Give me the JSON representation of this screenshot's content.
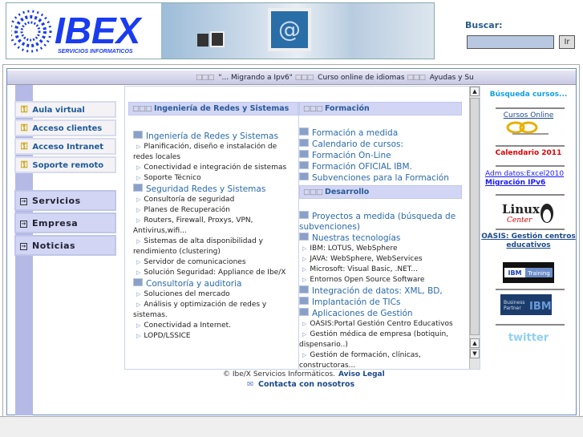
{
  "header": {
    "logo_text": "IBEX",
    "logo_sub": "SERVICIOS INFORMATICOS",
    "search_label": "Buscar:",
    "search_value": "",
    "search_button": "Ir"
  },
  "ticker": {
    "items": [
      "\"... Migrando a Ipv6\"",
      "Curso online de idiomas",
      "Ayudas y Su"
    ]
  },
  "left_menu": {
    "access": [
      "Aula virtual",
      "Acceso clientes",
      "Acceso Intranet",
      "Soporte remoto"
    ],
    "nav": [
      "Servicios",
      "Empresa",
      "Noticias"
    ]
  },
  "content": {
    "col1": {
      "title": "Ingeniería de Redes y Sistemas",
      "blocks": [
        {
          "heading": "Ingeniería de Redes y Sistemas",
          "items": [
            "Planificación, diseño e instalación de redes locales",
            "Conectividad e integración de sistemas",
            "Soporte Técnico"
          ]
        },
        {
          "heading": "Seguridad Redes y Sistemas",
          "items": [
            "Consultoría de seguridad",
            "Planes de Recuperación",
            "Routers, Firewall, Proxys, VPN, Antivirus,wifi...",
            "Sistemas de alta disponibilidad y rendimiento (clustering)",
            "Servidor de comunicaciones",
            "Solución Seguridad: Appliance de Ibe/X"
          ]
        },
        {
          "heading": "Consultoría y auditoria",
          "items": [
            "Soluciones del mercado",
            "Análisis y optimización de redes y sistemas.",
            "Conectividad a Internet.",
            "LOPD/LSSICE"
          ]
        }
      ]
    },
    "col2": {
      "title": "Formación",
      "headings": [
        "Formación a medida",
        "Calendario de cursos:",
        "Formación On-Line",
        "Formación OFICIAL IBM.",
        "Subvenciones para la Formación"
      ]
    },
    "col3": {
      "title": "Desarrollo",
      "blocks": [
        {
          "heading": "Proyectos a medida (búsqueda de subvenciones)",
          "items": []
        },
        {
          "heading": "Nuestras tecnologías",
          "items": [
            "IBM: LOTUS, WebSphere",
            "JAVA: WebSphere, WebServices",
            "Microsoft: Visual Basic, .NET...",
            "Entornos Open Source Software"
          ]
        },
        {
          "heading": "Integración de datos: XML, BD,",
          "items": []
        },
        {
          "heading": "Implantación de TICs",
          "items": []
        },
        {
          "heading": "Aplicaciones de Gestión",
          "items": [
            "OASIS:Portal Gestión Centro Educativos",
            "Gestión médica de empresa (botiquin, dispensario..)",
            "Gestión de formación, clínicas, constructoras..."
          ]
        }
      ]
    }
  },
  "right": {
    "search_courses": "Búsqueda cursos...",
    "courses_online": "Cursos Online",
    "calendar": "Calendario 2011",
    "link1": "Adm datos:Excel2010",
    "link2": "Migración IPv6",
    "linux_logo": "Linux Center",
    "oasis": "OASIS: Gestión centros educativos",
    "ibm_training": "IBM Training",
    "ibm_partner": "Business Partner IBM",
    "twitter": "twitter"
  },
  "footer": {
    "copyright": "© Ibe/X Servicios Informáticos.",
    "legal": "Aviso Legal",
    "contact": "Contacta con nosotros"
  },
  "colors": {
    "accent": "#1c5a9c",
    "lavender": "#d2d6f4",
    "red": "#e00000"
  }
}
